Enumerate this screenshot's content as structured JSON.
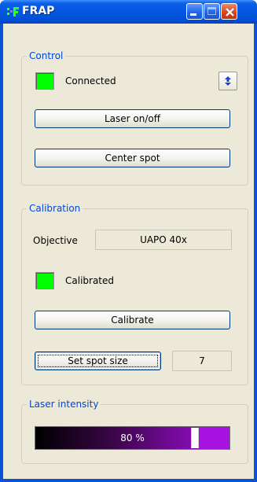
{
  "window": {
    "title": "FRAP"
  },
  "control": {
    "legend": "Control",
    "status_label": "Connected",
    "status_color": "#00ff00",
    "laser_button": "Laser on/off",
    "center_button": "Center spot",
    "sync_icon": "sync-arrows-icon"
  },
  "calibration": {
    "legend": "Calibration",
    "objective_label": "Objective",
    "objective_value": "UAPO 40x",
    "status_label": "Calibrated",
    "status_color": "#00ff00",
    "calibrate_button": "Calibrate",
    "spot_size_button": "Set spot size",
    "spot_size_value": "7"
  },
  "laser": {
    "legend": "Laser intensity",
    "intensity_text": "80 %",
    "intensity_percent": 80
  },
  "colors": {
    "titlebar": "#0556df",
    "client_bg": "#ece9d8",
    "legend_text": "#0046d5",
    "close_button": "#d3441c"
  }
}
